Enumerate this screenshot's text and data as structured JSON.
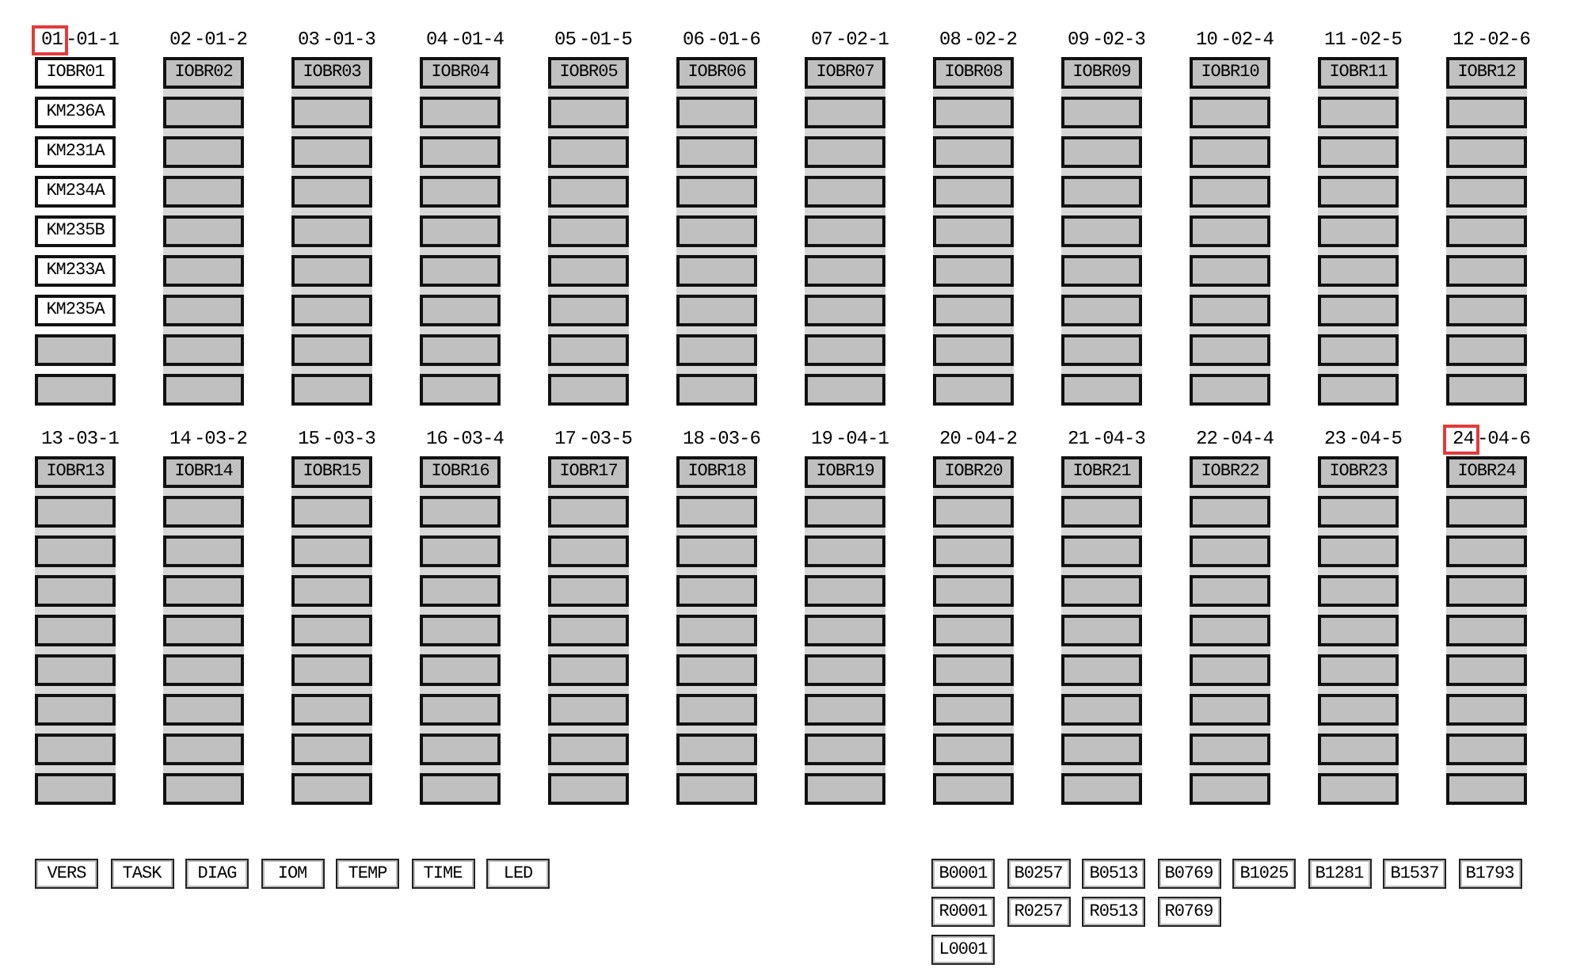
{
  "racks": [
    {
      "number": "01",
      "position": "-01-1",
      "highlighted": true,
      "active": true,
      "header": "IOBR01",
      "slots": [
        {
          "label": "KM236A",
          "active": true
        },
        {
          "label": "KM231A",
          "active": true
        },
        {
          "label": "KM234A",
          "active": true
        },
        {
          "label": "KM235B",
          "active": true
        },
        {
          "label": "KM233A",
          "active": true
        },
        {
          "label": "KM235A",
          "active": true
        },
        {
          "active": false
        },
        {
          "active": false
        }
      ]
    },
    {
      "number": "02",
      "position": "-01-2",
      "highlighted": false,
      "active": false,
      "header": "IOBR02",
      "slots": [
        {
          "active": false
        },
        {
          "active": false
        },
        {
          "active": false
        },
        {
          "active": false
        },
        {
          "active": false
        },
        {
          "active": false
        },
        {
          "active": false
        },
        {
          "active": false
        }
      ]
    },
    {
      "number": "03",
      "position": "-01-3",
      "highlighted": false,
      "active": false,
      "header": "IOBR03",
      "slots": [
        {
          "active": false
        },
        {
          "active": false
        },
        {
          "active": false
        },
        {
          "active": false
        },
        {
          "active": false
        },
        {
          "active": false
        },
        {
          "active": false
        },
        {
          "active": false
        }
      ]
    },
    {
      "number": "04",
      "position": "-01-4",
      "highlighted": false,
      "active": false,
      "header": "IOBR04",
      "slots": [
        {
          "active": false
        },
        {
          "active": false
        },
        {
          "active": false
        },
        {
          "active": false
        },
        {
          "active": false
        },
        {
          "active": false
        },
        {
          "active": false
        },
        {
          "active": false
        }
      ]
    },
    {
      "number": "05",
      "position": "-01-5",
      "highlighted": false,
      "active": false,
      "header": "IOBR05",
      "slots": [
        {
          "active": false
        },
        {
          "active": false
        },
        {
          "active": false
        },
        {
          "active": false
        },
        {
          "active": false
        },
        {
          "active": false
        },
        {
          "active": false
        },
        {
          "active": false
        }
      ]
    },
    {
      "number": "06",
      "position": "-01-6",
      "highlighted": false,
      "active": false,
      "header": "IOBR06",
      "slots": [
        {
          "active": false
        },
        {
          "active": false
        },
        {
          "active": false
        },
        {
          "active": false
        },
        {
          "active": false
        },
        {
          "active": false
        },
        {
          "active": false
        },
        {
          "active": false
        }
      ]
    },
    {
      "number": "07",
      "position": "-02-1",
      "highlighted": false,
      "active": false,
      "header": "IOBR07",
      "slots": [
        {
          "active": false
        },
        {
          "active": false
        },
        {
          "active": false
        },
        {
          "active": false
        },
        {
          "active": false
        },
        {
          "active": false
        },
        {
          "active": false
        },
        {
          "active": false
        }
      ]
    },
    {
      "number": "08",
      "position": "-02-2",
      "highlighted": false,
      "active": false,
      "header": "IOBR08",
      "slots": [
        {
          "active": false
        },
        {
          "active": false
        },
        {
          "active": false
        },
        {
          "active": false
        },
        {
          "active": false
        },
        {
          "active": false
        },
        {
          "active": false
        },
        {
          "active": false
        }
      ]
    },
    {
      "number": "09",
      "position": "-02-3",
      "highlighted": false,
      "active": false,
      "header": "IOBR09",
      "slots": [
        {
          "active": false
        },
        {
          "active": false
        },
        {
          "active": false
        },
        {
          "active": false
        },
        {
          "active": false
        },
        {
          "active": false
        },
        {
          "active": false
        },
        {
          "active": false
        }
      ]
    },
    {
      "number": "10",
      "position": "-02-4",
      "highlighted": false,
      "active": false,
      "header": "IOBR10",
      "slots": [
        {
          "active": false
        },
        {
          "active": false
        },
        {
          "active": false
        },
        {
          "active": false
        },
        {
          "active": false
        },
        {
          "active": false
        },
        {
          "active": false
        },
        {
          "active": false
        }
      ]
    },
    {
      "number": "11",
      "position": "-02-5",
      "highlighted": false,
      "active": false,
      "header": "IOBR11",
      "slots": [
        {
          "active": false
        },
        {
          "active": false
        },
        {
          "active": false
        },
        {
          "active": false
        },
        {
          "active": false
        },
        {
          "active": false
        },
        {
          "active": false
        },
        {
          "active": false
        }
      ]
    },
    {
      "number": "12",
      "position": "-02-6",
      "highlighted": false,
      "active": false,
      "header": "IOBR12",
      "slots": [
        {
          "active": false
        },
        {
          "active": false
        },
        {
          "active": false
        },
        {
          "active": false
        },
        {
          "active": false
        },
        {
          "active": false
        },
        {
          "active": false
        },
        {
          "active": false
        }
      ]
    },
    {
      "number": "13",
      "position": "-03-1",
      "highlighted": false,
      "active": false,
      "header": "IOBR13",
      "slots": [
        {
          "active": false
        },
        {
          "active": false
        },
        {
          "active": false
        },
        {
          "active": false
        },
        {
          "active": false
        },
        {
          "active": false
        },
        {
          "active": false
        },
        {
          "active": false
        }
      ]
    },
    {
      "number": "14",
      "position": "-03-2",
      "highlighted": false,
      "active": false,
      "header": "IOBR14",
      "slots": [
        {
          "active": false
        },
        {
          "active": false
        },
        {
          "active": false
        },
        {
          "active": false
        },
        {
          "active": false
        },
        {
          "active": false
        },
        {
          "active": false
        },
        {
          "active": false
        }
      ]
    },
    {
      "number": "15",
      "position": "-03-3",
      "highlighted": false,
      "active": false,
      "header": "IOBR15",
      "slots": [
        {
          "active": false
        },
        {
          "active": false
        },
        {
          "active": false
        },
        {
          "active": false
        },
        {
          "active": false
        },
        {
          "active": false
        },
        {
          "active": false
        },
        {
          "active": false
        }
      ]
    },
    {
      "number": "16",
      "position": "-03-4",
      "highlighted": false,
      "active": false,
      "header": "IOBR16",
      "slots": [
        {
          "active": false
        },
        {
          "active": false
        },
        {
          "active": false
        },
        {
          "active": false
        },
        {
          "active": false
        },
        {
          "active": false
        },
        {
          "active": false
        },
        {
          "active": false
        }
      ]
    },
    {
      "number": "17",
      "position": "-03-5",
      "highlighted": false,
      "active": false,
      "header": "IOBR17",
      "slots": [
        {
          "active": false
        },
        {
          "active": false
        },
        {
          "active": false
        },
        {
          "active": false
        },
        {
          "active": false
        },
        {
          "active": false
        },
        {
          "active": false
        },
        {
          "active": false
        }
      ]
    },
    {
      "number": "18",
      "position": "-03-6",
      "highlighted": false,
      "active": false,
      "header": "IOBR18",
      "slots": [
        {
          "active": false
        },
        {
          "active": false
        },
        {
          "active": false
        },
        {
          "active": false
        },
        {
          "active": false
        },
        {
          "active": false
        },
        {
          "active": false
        },
        {
          "active": false
        }
      ]
    },
    {
      "number": "19",
      "position": "-04-1",
      "highlighted": false,
      "active": false,
      "header": "IOBR19",
      "slots": [
        {
          "active": false
        },
        {
          "active": false
        },
        {
          "active": false
        },
        {
          "active": false
        },
        {
          "active": false
        },
        {
          "active": false
        },
        {
          "active": false
        },
        {
          "active": false
        }
      ]
    },
    {
      "number": "20",
      "position": "-04-2",
      "highlighted": false,
      "active": false,
      "header": "IOBR20",
      "slots": [
        {
          "active": false
        },
        {
          "active": false
        },
        {
          "active": false
        },
        {
          "active": false
        },
        {
          "active": false
        },
        {
          "active": false
        },
        {
          "active": false
        },
        {
          "active": false
        }
      ]
    },
    {
      "number": "21",
      "position": "-04-3",
      "highlighted": false,
      "active": false,
      "header": "IOBR21",
      "slots": [
        {
          "active": false
        },
        {
          "active": false
        },
        {
          "active": false
        },
        {
          "active": false
        },
        {
          "active": false
        },
        {
          "active": false
        },
        {
          "active": false
        },
        {
          "active": false
        }
      ]
    },
    {
      "number": "22",
      "position": "-04-4",
      "highlighted": false,
      "active": false,
      "header": "IOBR22",
      "slots": [
        {
          "active": false
        },
        {
          "active": false
        },
        {
          "active": false
        },
        {
          "active": false
        },
        {
          "active": false
        },
        {
          "active": false
        },
        {
          "active": false
        },
        {
          "active": false
        }
      ]
    },
    {
      "number": "23",
      "position": "-04-5",
      "highlighted": false,
      "active": false,
      "header": "IOBR23",
      "slots": [
        {
          "active": false
        },
        {
          "active": false
        },
        {
          "active": false
        },
        {
          "active": false
        },
        {
          "active": false
        },
        {
          "active": false
        },
        {
          "active": false
        },
        {
          "active": false
        }
      ]
    },
    {
      "number": "24",
      "position": "-04-6",
      "highlighted": true,
      "active": false,
      "header": "IOBR24",
      "slots": [
        {
          "active": false
        },
        {
          "active": false
        },
        {
          "active": false
        },
        {
          "active": false
        },
        {
          "active": false
        },
        {
          "active": false
        },
        {
          "active": false
        },
        {
          "active": false
        }
      ]
    }
  ],
  "function_buttons": [
    "VERS",
    "TASK",
    "DIAG",
    "IOM",
    "TEMP",
    "TIME",
    "LED"
  ],
  "address_buttons": [
    [
      "B0001",
      "B0257",
      "B0513",
      "B0769",
      "B1025",
      "B1281",
      "B1537",
      "B1793"
    ],
    [
      "R0001",
      "R0257",
      "R0513",
      "R0769"
    ],
    [
      "L0001"
    ]
  ]
}
